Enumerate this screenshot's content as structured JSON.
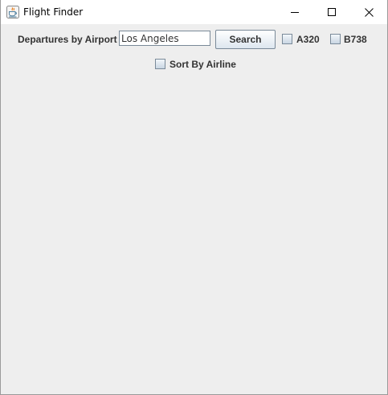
{
  "window": {
    "title": "Flight Finder",
    "app_icon": "java-cup-icon",
    "controls": {
      "minimize_icon": "minimize-icon",
      "maximize_icon": "maximize-icon",
      "close_icon": "close-icon"
    }
  },
  "search_panel": {
    "departures_label": "Departures by Airport",
    "airport_input_value": "Los Angeles",
    "search_button_label": "Search",
    "a320_label": "A320",
    "a320_checked": false,
    "b738_label": "B738",
    "b738_checked": false,
    "sort_by_airline_label": "Sort By Airline",
    "sort_by_airline_checked": false
  },
  "colors": {
    "panel_background": "#eeeeee",
    "titlebar_background": "#ffffff",
    "label_text": "#333333",
    "control_border": "#7a8a99"
  }
}
